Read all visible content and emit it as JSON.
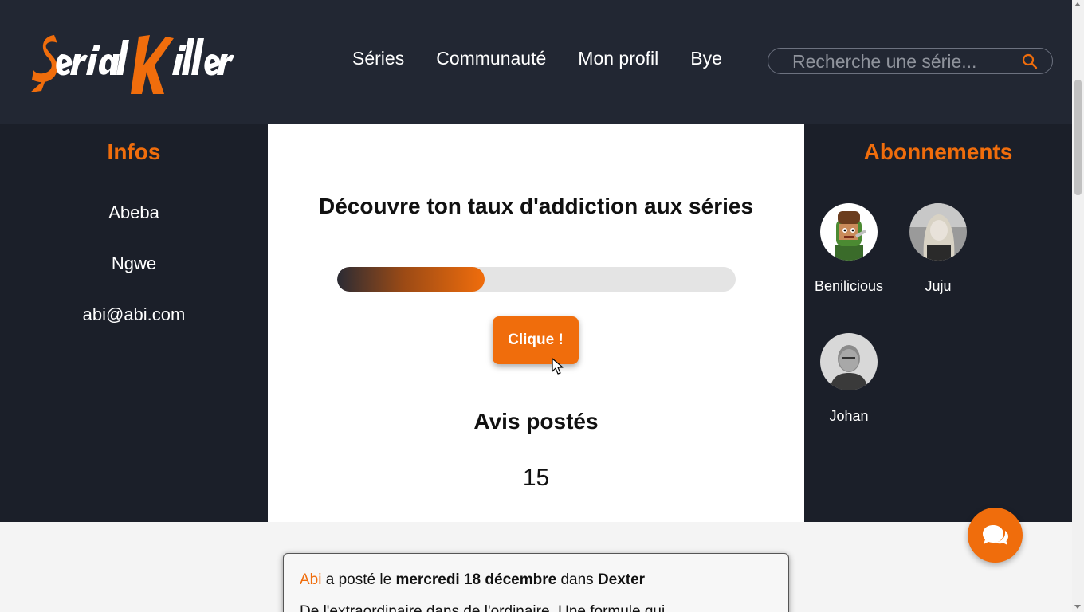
{
  "header": {
    "logo_text": "Serial Killer",
    "nav": [
      "Séries",
      "Communauté",
      "Mon profil",
      "Bye"
    ],
    "search_placeholder": "Recherche une série..."
  },
  "infos": {
    "title": "Infos",
    "first_name": "Abeba",
    "last_name": "Ngwe",
    "email": "abi@abi.com"
  },
  "main": {
    "addiction_title": "Découvre ton taux d'addiction aux séries",
    "addiction_progress": 0.37,
    "button_label": "Clique !",
    "avis_title": "Avis postés",
    "avis_count": "15"
  },
  "subscriptions": {
    "title": "Abonnements",
    "users": [
      {
        "name": "Benilicious"
      },
      {
        "name": "Juju"
      },
      {
        "name": "Johan"
      }
    ]
  },
  "post": {
    "author": "Abi",
    "text_posted": "a posté le",
    "date": "mercredi 18 décembre",
    "text_in": "dans",
    "series": "Dexter",
    "excerpt": "De l'extraordinaire dans de l'ordinaire. Une formule qui"
  },
  "colors": {
    "accent": "#f06d0c",
    "header_bg": "#222733",
    "panel_bg": "#1b1f29"
  },
  "icons": [
    "search-icon",
    "chat-icon",
    "cursor-icon",
    "scroll-up-icon",
    "scroll-down-icon"
  ]
}
